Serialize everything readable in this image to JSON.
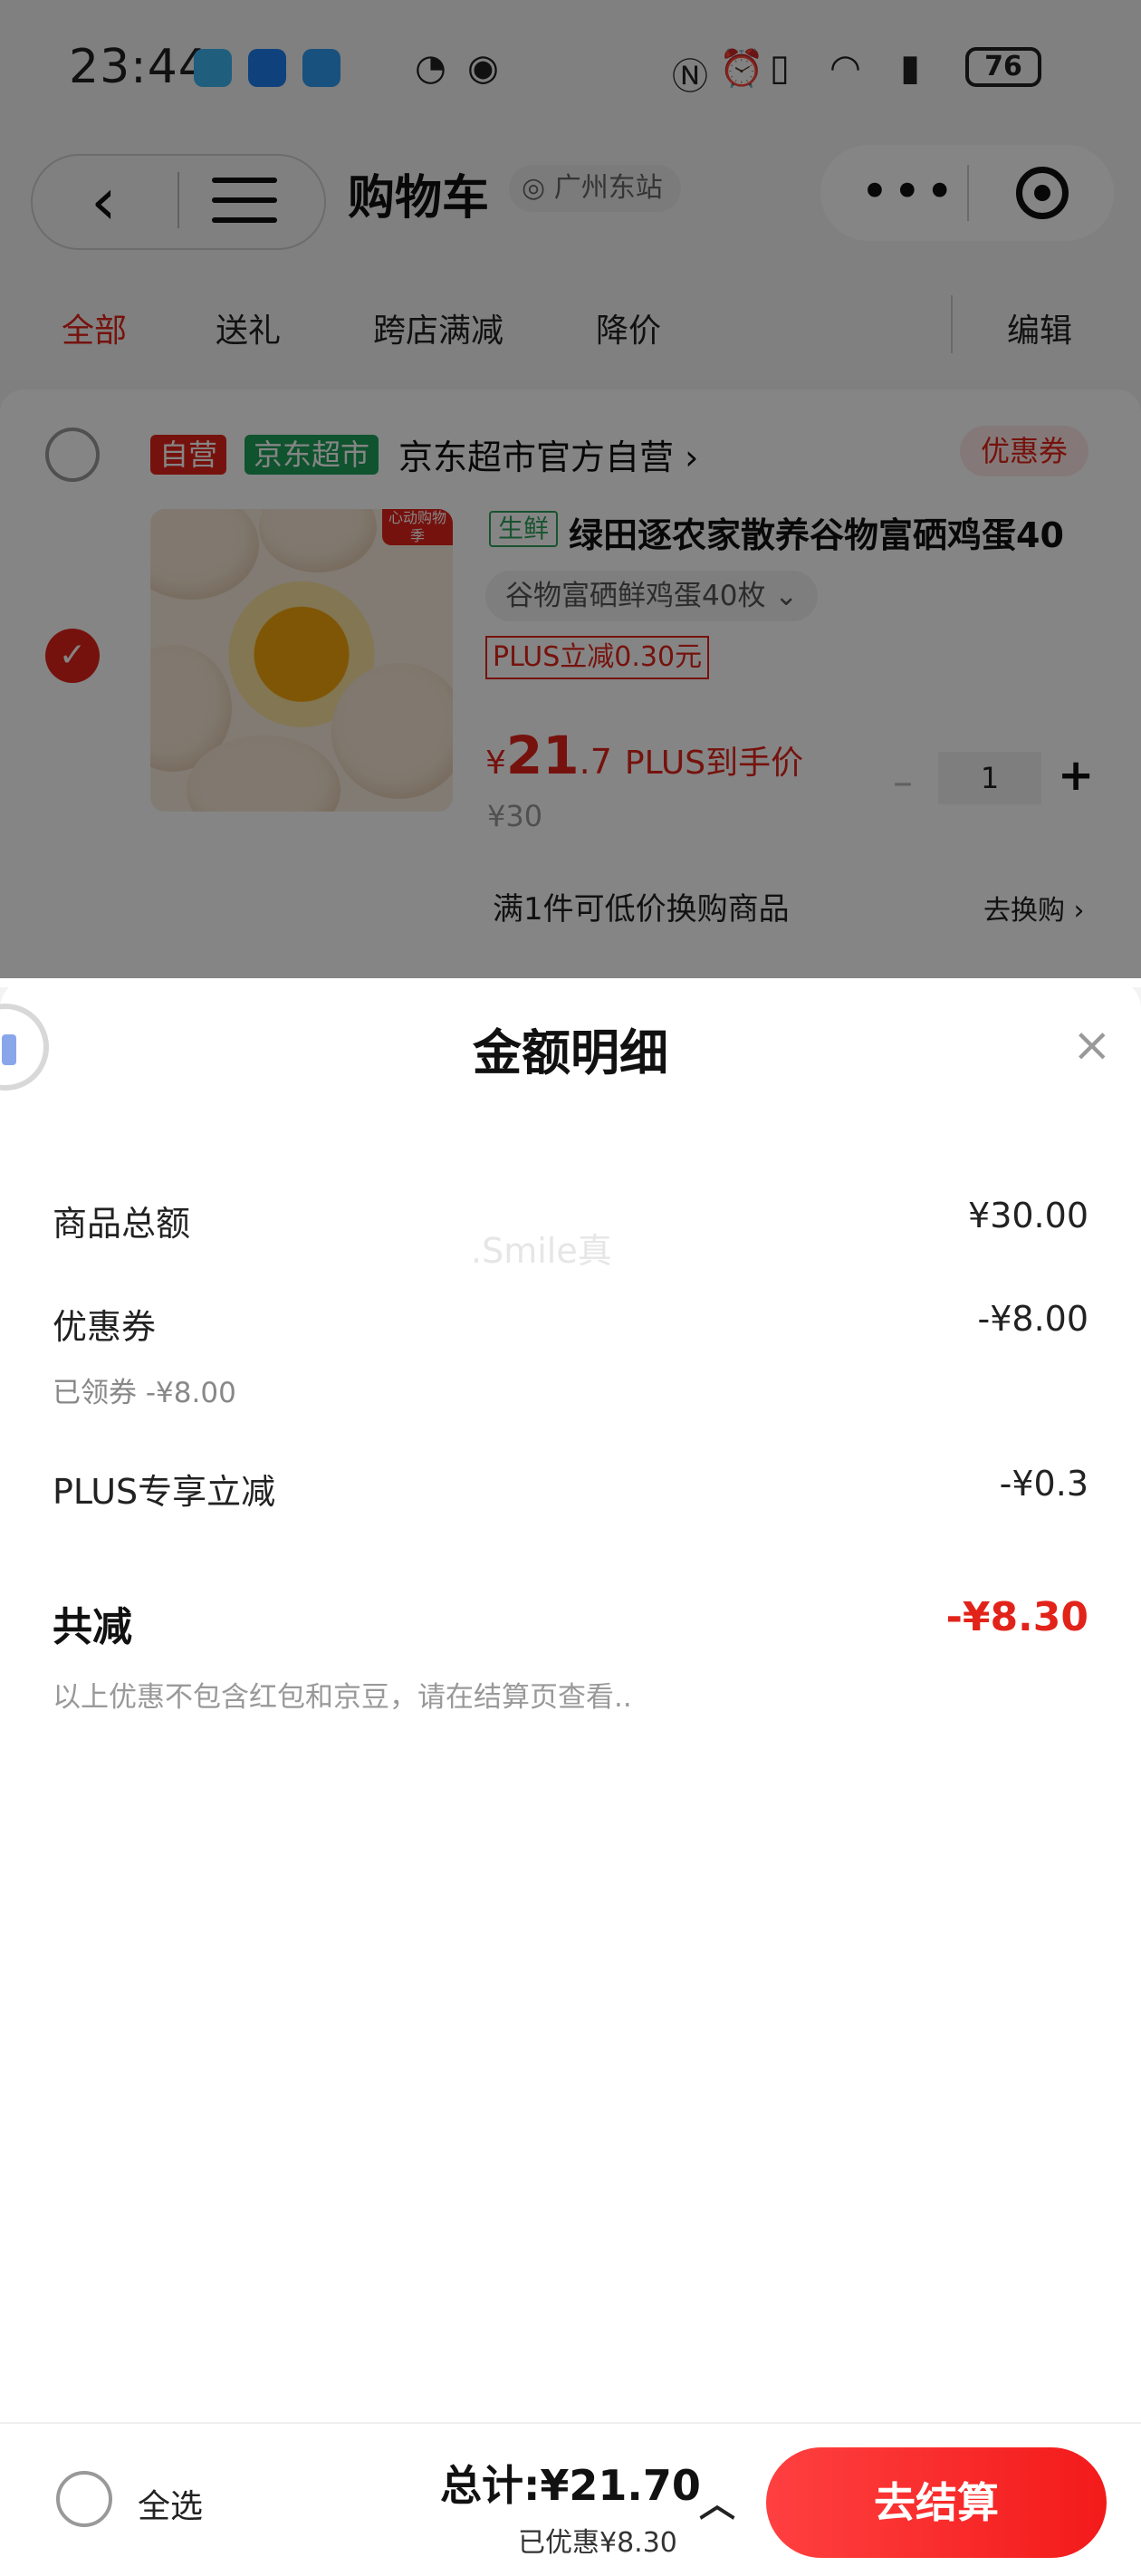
{
  "status_bar": {
    "time": "23:44",
    "battery": "76"
  },
  "nav": {
    "title": "购物车",
    "location": "广州东站"
  },
  "tabs": [
    "全部",
    "送礼",
    "跨店满减",
    "降价"
  ],
  "edit_label": "编辑",
  "shop": {
    "tag_self": "自营",
    "tag_market": "京东超市",
    "name": "京东超市官方自营 ›",
    "coupon": "优惠券"
  },
  "product": {
    "thumb_tag": "心动购物季",
    "fresh_tag": "生鲜",
    "name": "绿田逐农家散养谷物富硒鸡蛋40",
    "spec": "谷物富硒鲜鸡蛋40枚  ⌄",
    "plus_discount": "PLUS立减0.30元",
    "price_yen": "¥",
    "price_int": "21",
    "price_dec": ".7",
    "price_note": "PLUS到手价",
    "original_price": "¥30",
    "minus": "–",
    "qty": "1",
    "plus": "+",
    "promo": "满1件可低价换购商品",
    "exchange": "去换购 ›"
  },
  "sheet": {
    "title": "金额明细",
    "close": "×",
    "watermark": ".Smile真",
    "rows": [
      {
        "label": "商品总额",
        "value": "¥30.00"
      },
      {
        "label": "优惠券",
        "value": "-¥8.00",
        "sub": "已领券 -¥8.00"
      },
      {
        "label": "PLUS专享立减",
        "value": "-¥0.3"
      }
    ],
    "total_label": "共减",
    "total_value": "-¥8.30",
    "note": "以上优惠不包含红包和京豆，请在结算页查看.."
  },
  "bottom": {
    "select_all": "全选",
    "total": "总计:¥21.70",
    "saved": "已优惠¥8.30",
    "chevron": "︿",
    "checkout": "去结算"
  },
  "colors": {
    "accent": "#e2231a",
    "green": "#2fa05a",
    "jd_market": "#1fa05b"
  }
}
